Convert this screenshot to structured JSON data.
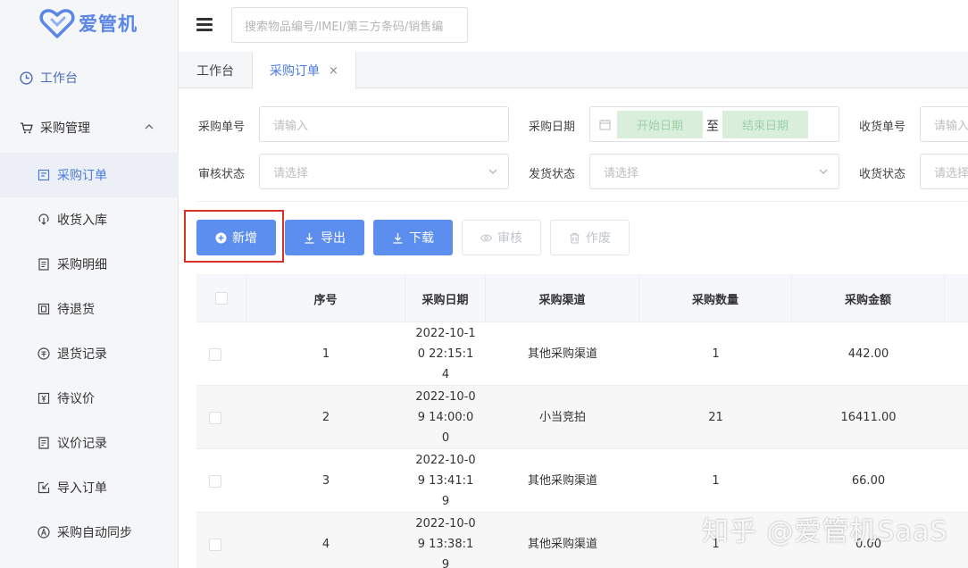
{
  "app": {
    "logo_text": "爱管机"
  },
  "header": {
    "search_placeholder": "搜索物品编号/IMEI/第三方条码/销售编"
  },
  "sidebar": {
    "workbench": "工作台",
    "group_label": "采购管理",
    "items": [
      {
        "label": "采购订单",
        "icon": "order-icon",
        "active": true
      },
      {
        "label": "收货入库",
        "icon": "receive-icon"
      },
      {
        "label": "采购明细",
        "icon": "detail-icon"
      },
      {
        "label": "待退货",
        "icon": "pending-return-icon"
      },
      {
        "label": "退货记录",
        "icon": "return-record-icon"
      },
      {
        "label": "待议价",
        "icon": "pending-bargain-icon"
      },
      {
        "label": "议价记录",
        "icon": "bargain-record-icon"
      },
      {
        "label": "导入订单",
        "icon": "import-icon"
      },
      {
        "label": "采购自动同步",
        "icon": "auto-sync-icon"
      }
    ]
  },
  "tabs": [
    {
      "label": "工作台",
      "active": false
    },
    {
      "label": "采购订单",
      "active": true,
      "close": "×"
    }
  ],
  "filters": {
    "order_no_label": "采购单号",
    "order_no_placeholder": "请输入",
    "date_label": "采购日期",
    "start_date": "开始日期",
    "date_sep": "至",
    "end_date": "结束日期",
    "receipt_no_label": "收货单号",
    "receipt_no_placeholder": "请输入",
    "audit_label": "审核状态",
    "audit_placeholder": "请选择",
    "ship_label": "发货状态",
    "ship_placeholder": "请选择",
    "receive_label": "收货状态",
    "receive_placeholder": "请选择"
  },
  "toolbar": {
    "add": "新增",
    "export": "导出",
    "download": "下载",
    "audit": "审核",
    "void": "作废"
  },
  "table": {
    "columns": [
      "序号",
      "采购日期",
      "采购渠道",
      "采购数量",
      "采购金额"
    ],
    "rows": [
      {
        "no": "1",
        "date": "2022-10-10 22:15:14",
        "channel": "其他采购渠道",
        "qty": "1",
        "amount": "442.00"
      },
      {
        "no": "2",
        "date": "2022-10-09 14:00:00",
        "channel": "小当竞拍",
        "qty": "21",
        "amount": "16411.00"
      },
      {
        "no": "3",
        "date": "2022-10-09 13:41:19",
        "channel": "其他采购渠道",
        "qty": "1",
        "amount": "66.00"
      },
      {
        "no": "4",
        "date": "2022-10-09 13:38:19",
        "channel": "其他采购渠道",
        "qty": "1",
        "amount": "0.00"
      }
    ]
  },
  "watermark": "知乎 @爱管机SaaS",
  "colors": {
    "primary": "#5c8ef0",
    "active_text": "#4a7be0",
    "highlight": "#d93025"
  }
}
